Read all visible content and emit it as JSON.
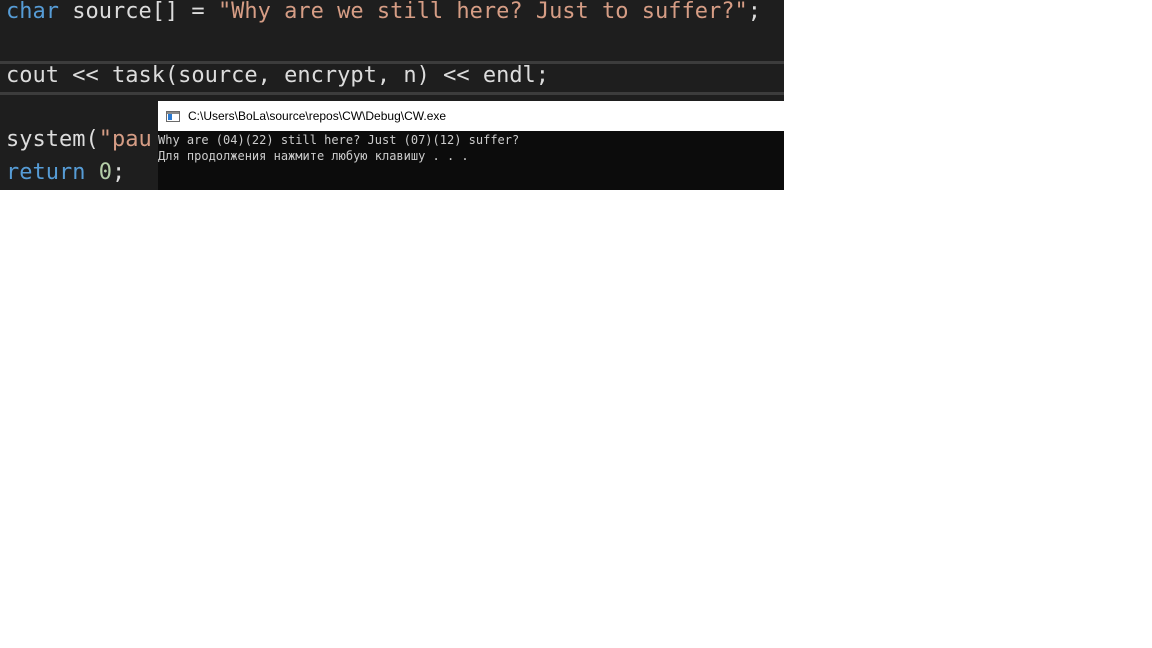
{
  "editor": {
    "line1": {
      "kw": "char",
      "ident": " source[] = ",
      "str": "\"Why are we still here? Just to suffer?\"",
      "end": ";"
    },
    "line2": {
      "text": "cout << task(source, encrypt, n) << endl;"
    },
    "line3": {
      "ident": "system(",
      "str": "\"pau"
    },
    "line4": {
      "kw": "return",
      "sp": " ",
      "num": "0",
      "end": ";"
    }
  },
  "console": {
    "title": "C:\\Users\\BoLa\\source\\repos\\CW\\Debug\\CW.exe",
    "output": [
      "Why are (04)(22) still here? Just (07)(12) suffer?",
      "Для продолжения нажмите любую клавишу . . ."
    ]
  },
  "colors": {
    "editor_bg": "#1e1e1e",
    "keyword": "#569cd6",
    "string": "#d69d85",
    "number": "#b5cea8",
    "console_bg": "#0c0c0c",
    "console_text": "#cccccc"
  },
  "icons": {
    "console_app": "console-window-icon"
  }
}
